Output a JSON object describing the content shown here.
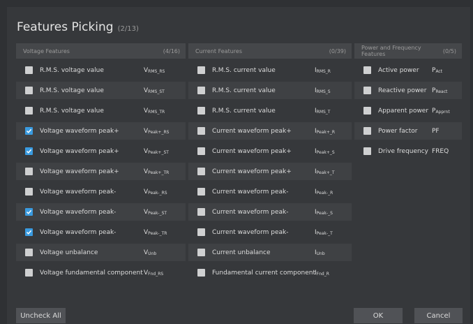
{
  "dialog": {
    "title": "Features Picking",
    "count": "(2/13)"
  },
  "columns": [
    {
      "title": "Voltage Features",
      "count": "(4/16)",
      "rows": [
        {
          "label": "R.M.S. voltage value",
          "sym": "V",
          "sub": "RMS_RS",
          "checked": false
        },
        {
          "label": "R.M.S. voltage value",
          "sym": "V",
          "sub": "RMS_ST",
          "checked": false
        },
        {
          "label": "R.M.S. voltage value",
          "sym": "V",
          "sub": "RMS_TR",
          "checked": false
        },
        {
          "label": "Voltage waveform peak+",
          "sym": "V",
          "sub": "Peak+_RS",
          "checked": true
        },
        {
          "label": "Voltage waveform peak+",
          "sym": "V",
          "sub": "Peak+_ST",
          "checked": true
        },
        {
          "label": "Voltage waveform peak+",
          "sym": "V",
          "sub": "Peak+_TR",
          "checked": false
        },
        {
          "label": "Voltage waveform peak-",
          "sym": "V",
          "sub": "Peak-_RS",
          "checked": false
        },
        {
          "label": "Voltage waveform peak-",
          "sym": "V",
          "sub": "Peak-_ST",
          "checked": true
        },
        {
          "label": "Voltage waveform peak-",
          "sym": "V",
          "sub": "Peak-_TR",
          "checked": true
        },
        {
          "label": "Voltage unbalance",
          "sym": "V",
          "sub": "Unb",
          "checked": false
        },
        {
          "label": "Voltage fundamental component",
          "sym": "V",
          "sub": "Fnd_RS",
          "checked": false
        }
      ]
    },
    {
      "title": "Current Features",
      "count": "(0/39)",
      "rows": [
        {
          "label": "R.M.S. current value",
          "sym": "I",
          "sub": "RMS_R",
          "checked": false
        },
        {
          "label": "R.M.S. current value",
          "sym": "I",
          "sub": "RMS_S",
          "checked": false
        },
        {
          "label": "R.M.S. current value",
          "sym": "I",
          "sub": "RMS_T",
          "checked": false
        },
        {
          "label": "Current waveform peak+",
          "sym": "I",
          "sub": "Peak+_R",
          "checked": false
        },
        {
          "label": "Current waveform peak+",
          "sym": "I",
          "sub": "Peak+_S",
          "checked": false
        },
        {
          "label": "Current waveform peak+",
          "sym": "I",
          "sub": "Peak+_T",
          "checked": false
        },
        {
          "label": "Current waveform peak-",
          "sym": "I",
          "sub": "Peak-_R",
          "checked": false
        },
        {
          "label": "Current waveform peak-",
          "sym": "I",
          "sub": "Peak-_S",
          "checked": false
        },
        {
          "label": "Current waveform peak-",
          "sym": "I",
          "sub": "Peak-_T",
          "checked": false
        },
        {
          "label": "Current unbalance",
          "sym": "I",
          "sub": "Unb",
          "checked": false
        },
        {
          "label": "Fundamental current component",
          "sym": "I",
          "sub": "Fnd_R",
          "checked": false
        }
      ]
    },
    {
      "title": "Power and Frequency Features",
      "count": "(0/5)",
      "rows": [
        {
          "label": "Active power",
          "sym": "P",
          "sub": "Act",
          "checked": false
        },
        {
          "label": "Reactive power",
          "sym": "P",
          "sub": "React",
          "checked": false
        },
        {
          "label": "Apparent power",
          "sym": "P",
          "sub": "Apprnt",
          "checked": false
        },
        {
          "label": "Power factor",
          "sym": "PF",
          "sub": "",
          "checked": false
        },
        {
          "label": "Drive frequency",
          "sym": "FREQ",
          "sub": "",
          "checked": false
        }
      ]
    }
  ],
  "footer": {
    "uncheck_all": "Uncheck All",
    "ok": "OK",
    "cancel": "Cancel"
  },
  "colors": {
    "checked": "#3a9be0",
    "unchecked": "#cfd0d1",
    "background": "#36383b"
  },
  "icons": {
    "check": "check-icon"
  }
}
